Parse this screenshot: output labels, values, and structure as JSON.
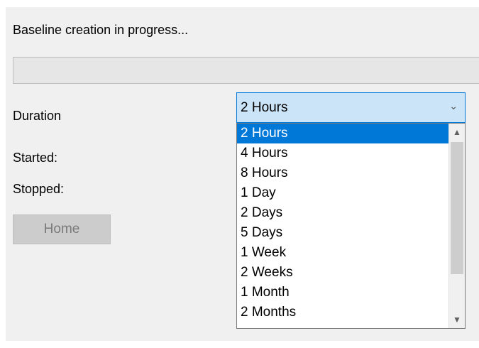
{
  "status": {
    "text": "Baseline creation in progress...",
    "progress": 0
  },
  "labels": {
    "duration": "Duration",
    "started": "Started:",
    "stopped": "Stopped:"
  },
  "home_button": {
    "label": "Home",
    "enabled": false
  },
  "duration_select": {
    "selected": "2 Hours",
    "arrow_icon": "chevron-down-icon",
    "options": [
      "2 Hours",
      "4 Hours",
      "8 Hours",
      "1 Day",
      "2 Days",
      "5 Days",
      "1 Week",
      "2 Weeks",
      "1 Month",
      "2 Months"
    ],
    "highlighted_index": 0
  },
  "scrollbar": {
    "up_icon": "chevron-up-icon",
    "down_icon": "chevron-down-icon"
  },
  "colors": {
    "accent": "#0078d7",
    "combo_bg": "#cce4f7",
    "panel_bg": "#f0f0f0",
    "button_disabled_bg": "#cccccc"
  }
}
